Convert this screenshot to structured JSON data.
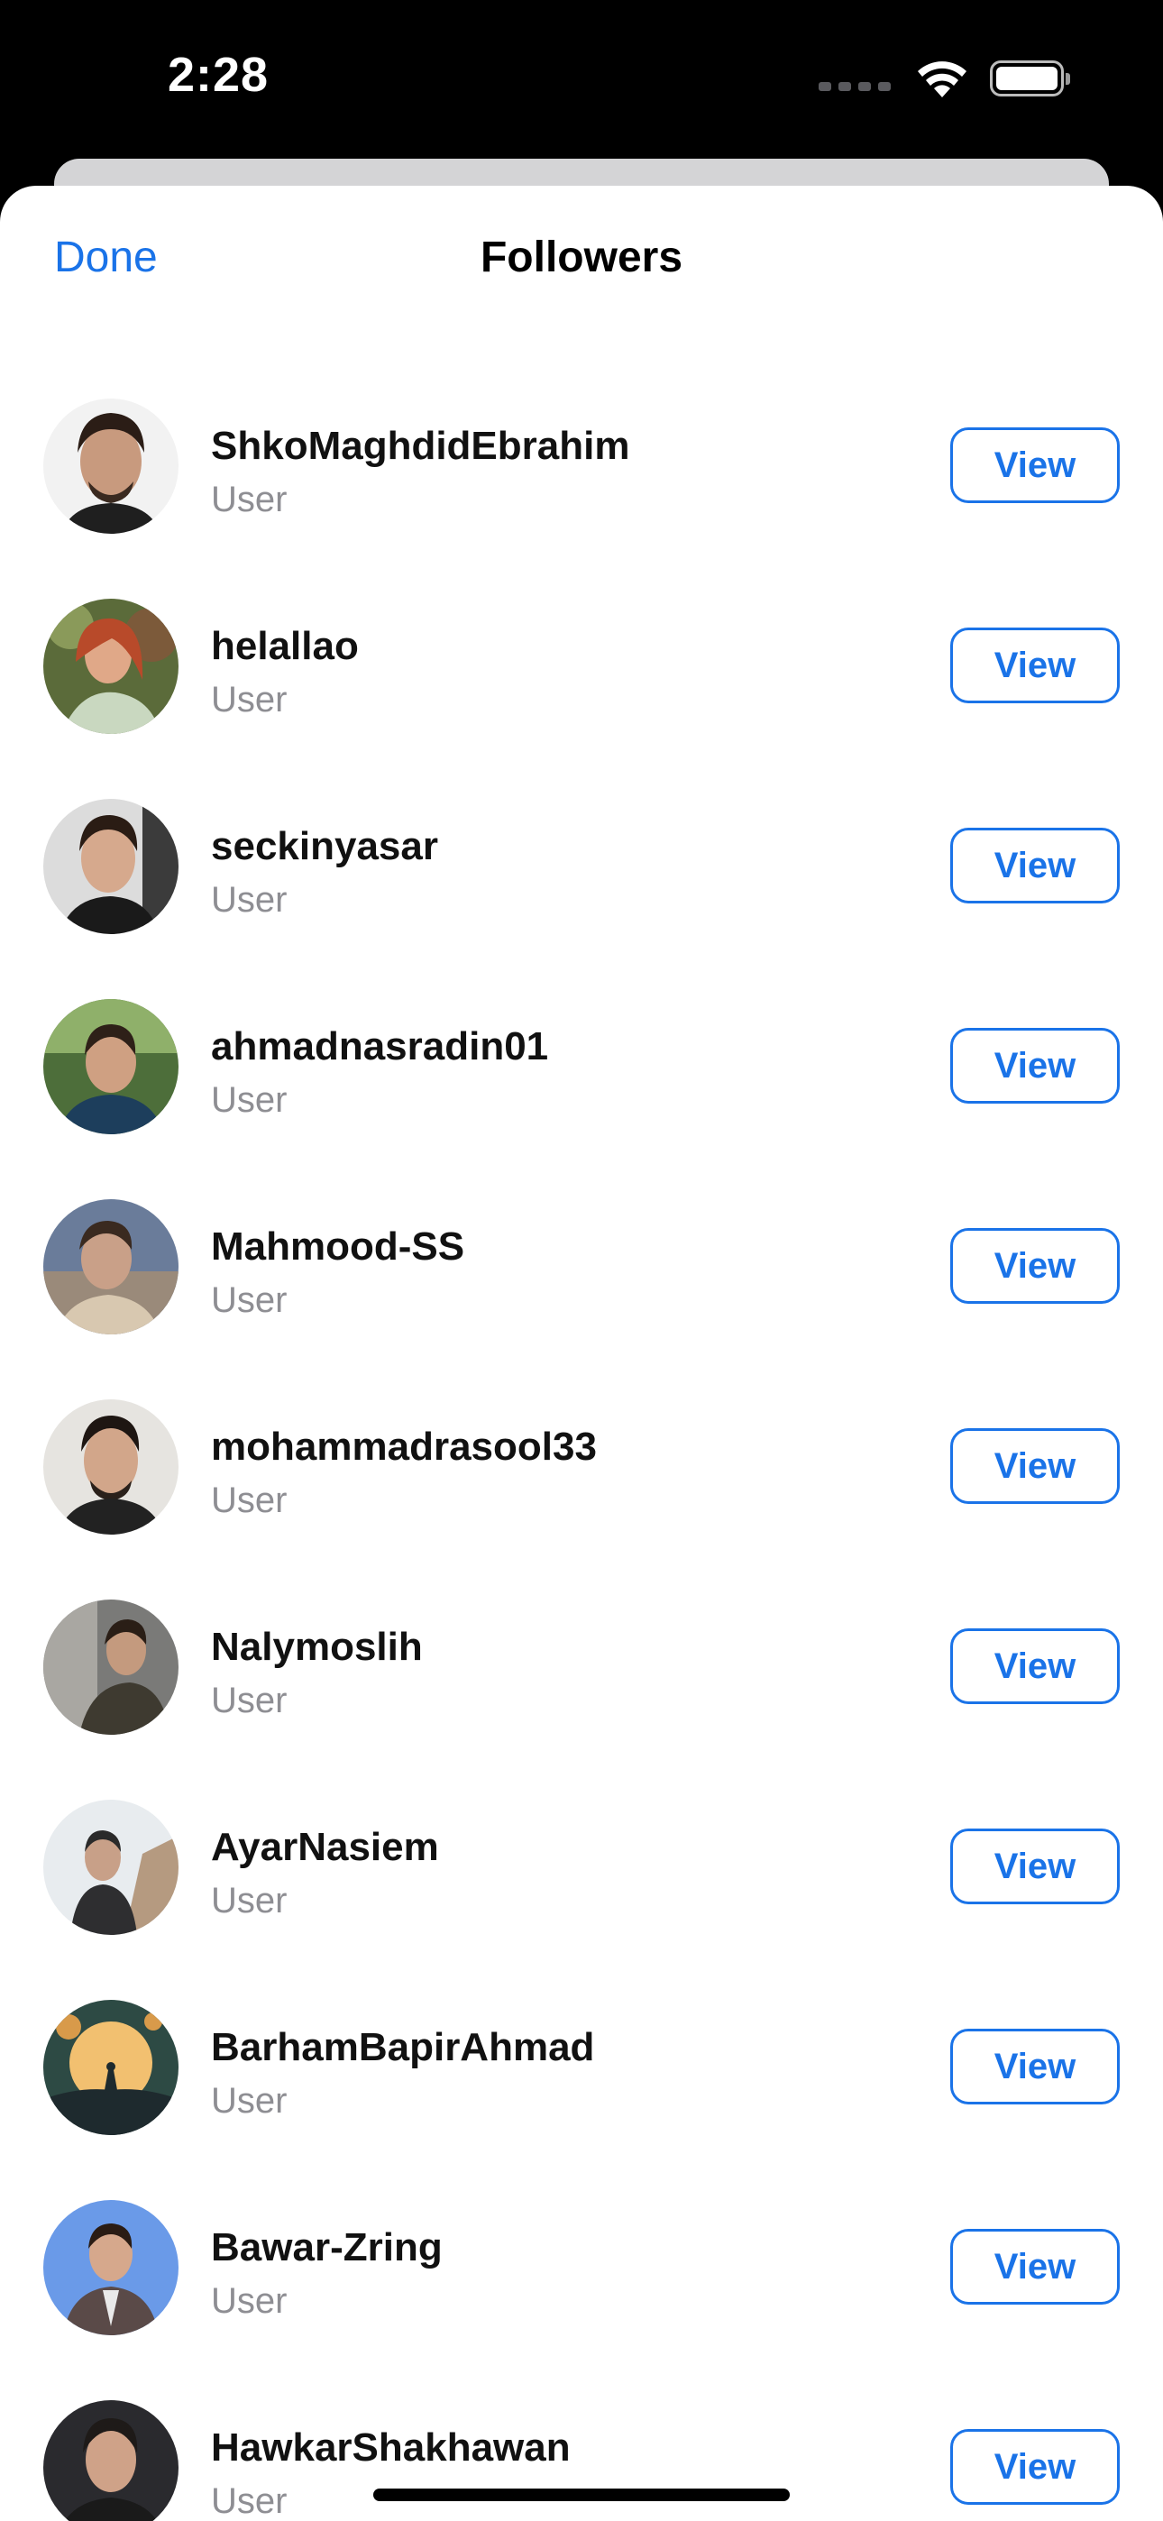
{
  "status_bar": {
    "time": "2:28",
    "icons": [
      "cellular-dots-icon",
      "wifi-icon",
      "battery-icon"
    ]
  },
  "nav": {
    "done_label": "Done",
    "title": "Followers"
  },
  "colors": {
    "accent": "#1a73e8",
    "secondary_text": "#8e8e93"
  },
  "followers": [
    {
      "name": "ShkoMaghdidEbrahim",
      "role": "User",
      "action": "View"
    },
    {
      "name": "helallao",
      "role": "User",
      "action": "View"
    },
    {
      "name": "seckinyasar",
      "role": "User",
      "action": "View"
    },
    {
      "name": "ahmadnasradin01",
      "role": "User",
      "action": "View"
    },
    {
      "name": "Mahmood-SS",
      "role": "User",
      "action": "View"
    },
    {
      "name": "mohammadrasool33",
      "role": "User",
      "action": "View"
    },
    {
      "name": "Nalymoslih",
      "role": "User",
      "action": "View"
    },
    {
      "name": "AyarNasiem",
      "role": "User",
      "action": "View"
    },
    {
      "name": "BarhamBapirAhmad",
      "role": "User",
      "action": "View"
    },
    {
      "name": "Bawar-Zring",
      "role": "User",
      "action": "View"
    },
    {
      "name": "HawkarShakhawan",
      "role": "User",
      "action": "View"
    }
  ]
}
